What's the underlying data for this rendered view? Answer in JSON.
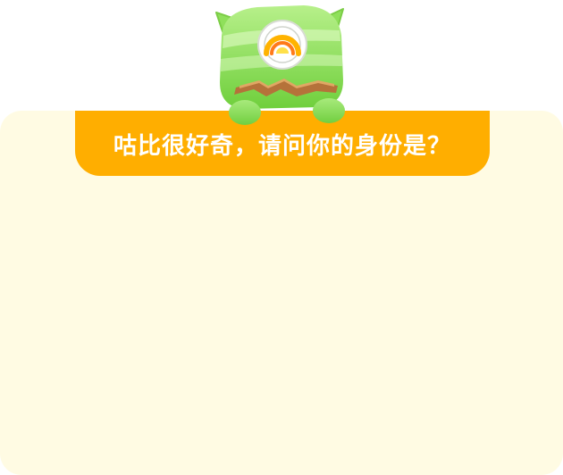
{
  "prompt": {
    "question": "咕比很好奇，请问你的身份是？"
  },
  "mascot": {
    "icon": "gubi-mascot-icon"
  },
  "colors": {
    "panel_background": "#fffbe3",
    "banner_background": "#ffae00",
    "banner_text": "#ffffff",
    "mascot_green": "#8ee05a"
  }
}
